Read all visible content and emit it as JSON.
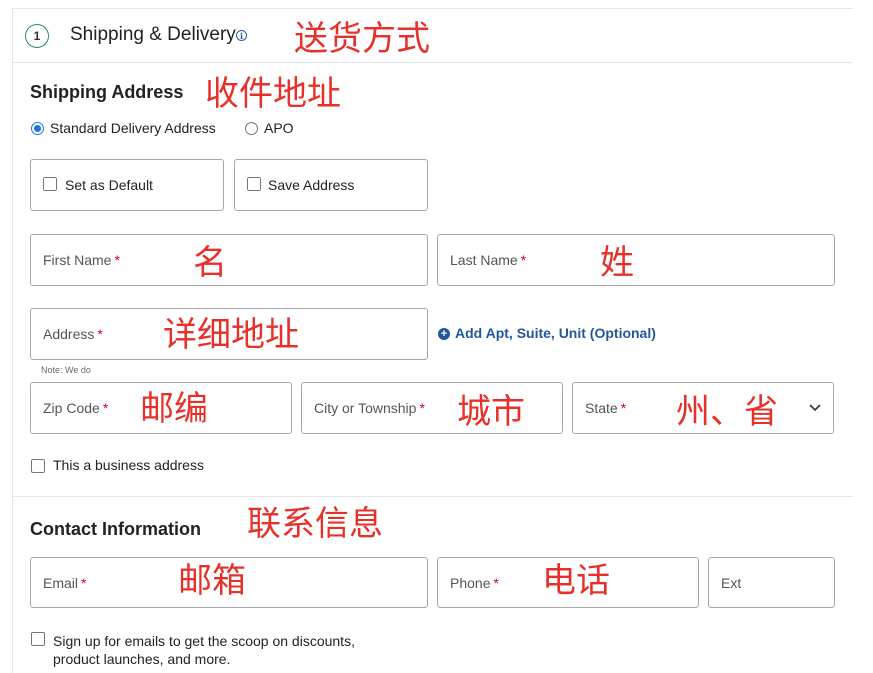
{
  "header": {
    "step_number": "1",
    "title": "Shipping & Delivery",
    "info_icon": "info-icon",
    "annotation": "送货方式"
  },
  "shipping_address": {
    "title": "Shipping Address",
    "annotation": "收件地址",
    "radio_options": [
      {
        "label": "Standard Delivery Address",
        "selected": true
      },
      {
        "label": "APO",
        "selected": false
      }
    ],
    "checkboxes": [
      {
        "label": "Set as Default",
        "checked": false
      },
      {
        "label": "Save Address",
        "checked": false
      }
    ],
    "fields": {
      "first_name": {
        "placeholder": "First Name",
        "required": "*",
        "annotation": "名"
      },
      "last_name": {
        "placeholder": "Last Name",
        "required": "*",
        "annotation": "姓"
      },
      "address": {
        "placeholder": "Address",
        "required": "*",
        "annotation": "详细地址",
        "note": "Note: We do"
      },
      "add_apt_link": "Add Apt, Suite, Unit (Optional)",
      "zip": {
        "placeholder": "Zip Code",
        "required": "*",
        "annotation": "邮编"
      },
      "city": {
        "placeholder": "City or Township",
        "required": "*",
        "annotation": "城市"
      },
      "state": {
        "placeholder": "State",
        "required": "*",
        "annotation": "州、省"
      }
    },
    "business_checkbox": {
      "label": "This a business address",
      "checked": false
    }
  },
  "contact_information": {
    "title": "Contact Information",
    "annotation": "联系信息",
    "fields": {
      "email": {
        "placeholder": "Email",
        "required": "*",
        "annotation": "邮箱"
      },
      "phone": {
        "placeholder": "Phone",
        "required": "*",
        "annotation": "电话"
      },
      "ext": {
        "placeholder": "Ext"
      }
    },
    "signup_checkbox": {
      "line1": "Sign up for emails to get the scoop on discounts,",
      "line2": "product launches, and more.",
      "checked": false
    }
  },
  "colors": {
    "accent_blue": "#24579a",
    "radio_blue": "#1a73e8",
    "required_red": "#d0021b",
    "annotation_red": "#e8302a",
    "step_green": "#2e8b57"
  }
}
